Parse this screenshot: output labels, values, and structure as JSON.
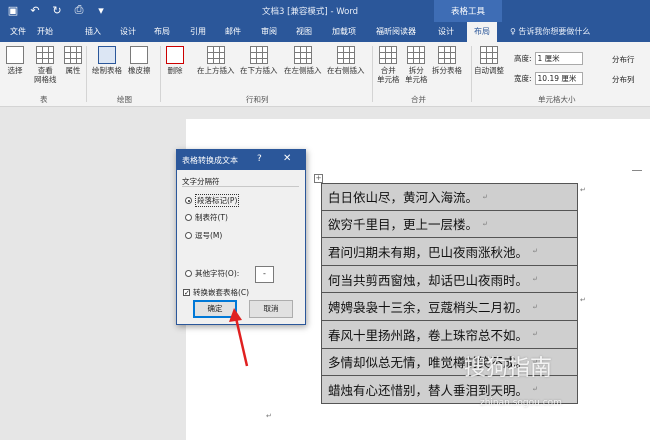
{
  "titlebar": {
    "doc_title": "文档3 [兼容模式] - Word",
    "context_tab_group": "表格工具"
  },
  "tabs": [
    "文件",
    "开始",
    "插入",
    "设计",
    "布局",
    "引用",
    "邮件",
    "审阅",
    "视图",
    "加载项",
    "福昕阅读器",
    "设计",
    "布局"
  ],
  "tell_me": "告诉我你想要做什么",
  "ribbon": {
    "select": "选择",
    "view_gridlines": "查看\n网格线",
    "properties": "属性",
    "draw_table": "绘制表格",
    "eraser": "橡皮擦",
    "delete": "删除",
    "insert_above": "在上方插入",
    "insert_below": "在下方插入",
    "insert_left": "在左侧插入",
    "insert_right": "在右侧插入",
    "merge_cells": "合并\n单元格",
    "split_cells": "拆分\n单元格",
    "split_table": "拆分表格",
    "autofit": "自动调整",
    "height_label": "高度:",
    "height_value": "1 厘米",
    "width_label": "宽度:",
    "width_value": "10.19 厘米",
    "dist_rows": "分布行",
    "dist_cols": "分布列",
    "groups": {
      "table": "表",
      "draw": "绘图",
      "rows_cols": "行和列",
      "merge": "合并",
      "cell_size": "单元格大小"
    }
  },
  "dialog": {
    "title": "表格转换成文本",
    "help": "?",
    "separator_label": "文字分隔符",
    "options": [
      {
        "label": "段落标记(P)",
        "selected": true
      },
      {
        "label": "制表符(T)",
        "selected": false
      },
      {
        "label": "逗号(M)",
        "selected": false
      },
      {
        "label": "其他字符(O):",
        "selected": false
      }
    ],
    "other_char": "-",
    "nested_checkbox": "转换嵌套表格(C)",
    "nested_checked": true,
    "ok": "确定",
    "cancel": "取消"
  },
  "table_rows": [
    "白日依山尽，黄河入海流。",
    "欲穷千里目，更上一层楼。",
    "君问归期未有期，巴山夜雨涨秋池。",
    "何当共剪西窗烛，却话巴山夜雨时。",
    "娉娉袅袅十三余，豆蔻梢头二月初。",
    "春风十里扬州路，卷上珠帘总不如。",
    "多情却似总无情，唯觉樽前笑不成。",
    "蜡烛有心还惜别，替人垂泪到天明。"
  ],
  "watermark": "搜狗指南",
  "watermark_url": "zhinan.sogou.com",
  "colors": {
    "word_blue": "#2b579a",
    "cell_fill": "#cfcfcf",
    "arrow": "#e02020"
  }
}
